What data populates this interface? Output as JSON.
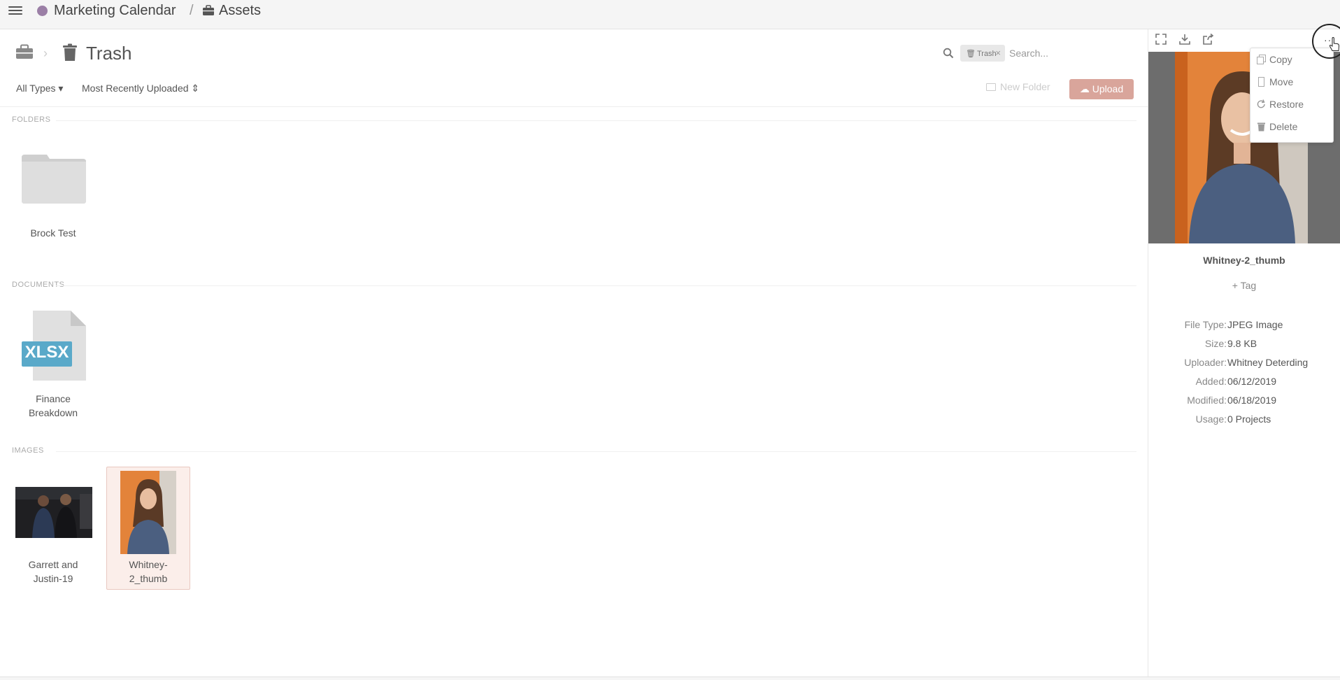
{
  "topbar": {
    "project_name": "Marketing Calendar",
    "separator": "/",
    "section": "Assets",
    "project_color": "#9b7fa6"
  },
  "header": {
    "title": "Trash",
    "breadcrumb_separator": "›"
  },
  "search": {
    "filter_chip": "Trash",
    "chip_close": "×",
    "placeholder": "Search..."
  },
  "toolbar": {
    "type_filter": "All Types ▾",
    "sort": "Most Recently Uploaded ⇕",
    "new_folder": "New Folder",
    "upload": "Upload"
  },
  "sections": {
    "folders": "FOLDERS",
    "documents": "DOCUMENTS",
    "images": "IMAGES"
  },
  "folders": [
    {
      "name": "Brock Test"
    }
  ],
  "documents": [
    {
      "name_line1": "Finance",
      "name_line2": "Breakdown",
      "badge": "XLSX"
    }
  ],
  "images": [
    {
      "name_line1": "Garrett and",
      "name_line2": "Justin-19"
    },
    {
      "name_line1": "Whitney-",
      "name_line2": "2_thumb"
    }
  ],
  "context_menu": {
    "items": [
      "Copy",
      "Move",
      "Restore",
      "Delete"
    ]
  },
  "details": {
    "file_name": "Whitney-2_thumb",
    "add_tag": "+ Tag",
    "more": "···",
    "fields": [
      {
        "label": "File Type:",
        "value": "JPEG Image"
      },
      {
        "label": "Size:",
        "value": "9.8 KB"
      },
      {
        "label": "Uploader:",
        "value": "Whitney Deterding"
      },
      {
        "label": "Added:",
        "value": "06/12/2019"
      },
      {
        "label": "Modified:",
        "value": "06/18/2019"
      },
      {
        "label": "Usage:",
        "value": "0 Projects"
      }
    ]
  },
  "colors": {
    "accent": "#d9a59b",
    "selection_bg": "#fbeeea",
    "xlsx_badge": "#5aa9c9"
  }
}
